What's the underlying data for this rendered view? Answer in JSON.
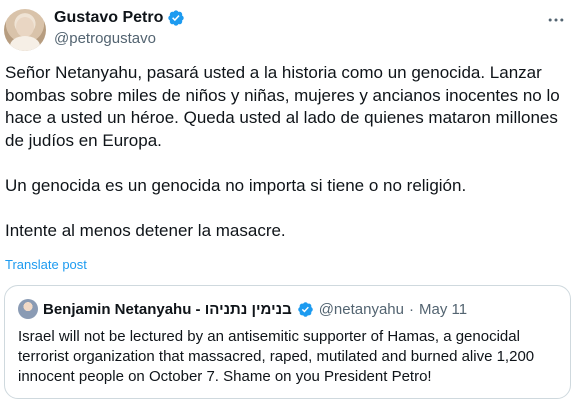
{
  "author": {
    "display_name": "Gustavo Petro",
    "handle": "@petrogustavo"
  },
  "tweet": {
    "paragraphs": [
      "Señor Netanyahu, pasará usted a la historia como un genocida. Lanzar bombas sobre miles de niños y niñas, mujeres y ancianos inocentes no lo hace a usted un héroe. Queda usted al lado de quienes mataron millones de judíos en Europa.",
      "Un genocida es un genocida no importa si tiene o no religión.",
      "Intente al menos detener la masacre."
    ],
    "translate_label": "Translate post"
  },
  "quote": {
    "display_name": "Benjamin Netanyahu - בנימין נתניהו",
    "handle": "@netanyahu",
    "separator": "·",
    "date": "May 11",
    "text": "Israel will not be lectured by an antisemitic supporter of Hamas, a genocidal terrorist organization that massacred, raped, mutilated and burned alive 1,200 innocent people on October 7. Shame on you President Petro!"
  },
  "icons": {
    "verified": "verified-badge-icon",
    "more": "more-options-icon"
  },
  "colors": {
    "verified_blue": "#1d9bf0",
    "link_blue": "#1d9bf0",
    "secondary_text": "#536471",
    "border": "#cfd9de"
  }
}
